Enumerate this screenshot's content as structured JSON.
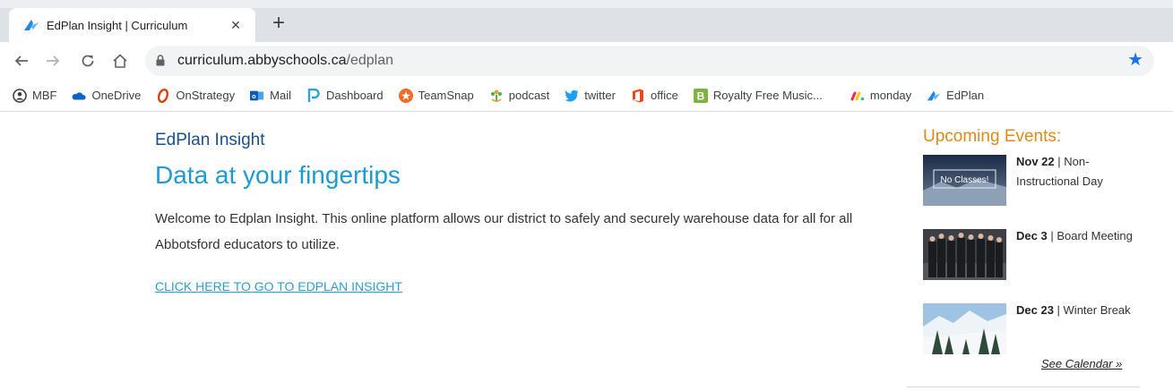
{
  "tab": {
    "title": "EdPlan Insight | Curriculum",
    "close": "×",
    "new_tab": "+"
  },
  "toolbar": {
    "url_host": "curriculum.abbyschools.ca",
    "url_path": "/edplan"
  },
  "bookmarks": [
    {
      "label": "MBF",
      "icon": "account-icon"
    },
    {
      "label": "OneDrive",
      "icon": "onedrive-icon"
    },
    {
      "label": "OnStrategy",
      "icon": "onstrategy-icon"
    },
    {
      "label": "Mail",
      "icon": "outlook-icon"
    },
    {
      "label": "Dashboard",
      "icon": "dashboard-icon"
    },
    {
      "label": "TeamSnap",
      "icon": "teamsnap-icon"
    },
    {
      "label": "podcast",
      "icon": "podcast-icon"
    },
    {
      "label": "twitter",
      "icon": "twitter-icon"
    },
    {
      "label": "office",
      "icon": "office-icon"
    },
    {
      "label": "Royalty Free Music...",
      "icon": "bensound-icon"
    },
    {
      "label": "monday",
      "icon": "monday-icon"
    },
    {
      "label": "EdPlan",
      "icon": "edplan-icon"
    }
  ],
  "page": {
    "brand": "EdPlan Insight",
    "headline": "Data at your fingertips",
    "intro": "Welcome to Edplan Insight.  This online platform allows our district to safely and securely warehouse data for all for all Abbotsford educators to utilize.",
    "cta": "CLICK HERE TO GO TO EDPLAN INSIGHT"
  },
  "events": {
    "title": "Upcoming Events:",
    "items": [
      {
        "date": "Nov 22",
        "sep": " | ",
        "name": "Non-Instructional Day",
        "thumb_text": "No Classes!"
      },
      {
        "date": "Dec 3",
        "sep": " | ",
        "name": "Board Meeting"
      },
      {
        "date": "Dec 23",
        "sep": " | ",
        "name": "Winter Break"
      }
    ],
    "see_calendar": "See Calendar »"
  },
  "colors": {
    "brand": "#1b4f8a",
    "headline": "#1f9bcf",
    "events_title": "#dc8a1e",
    "link": "#2a9fd0",
    "star": "#1a73e8"
  }
}
